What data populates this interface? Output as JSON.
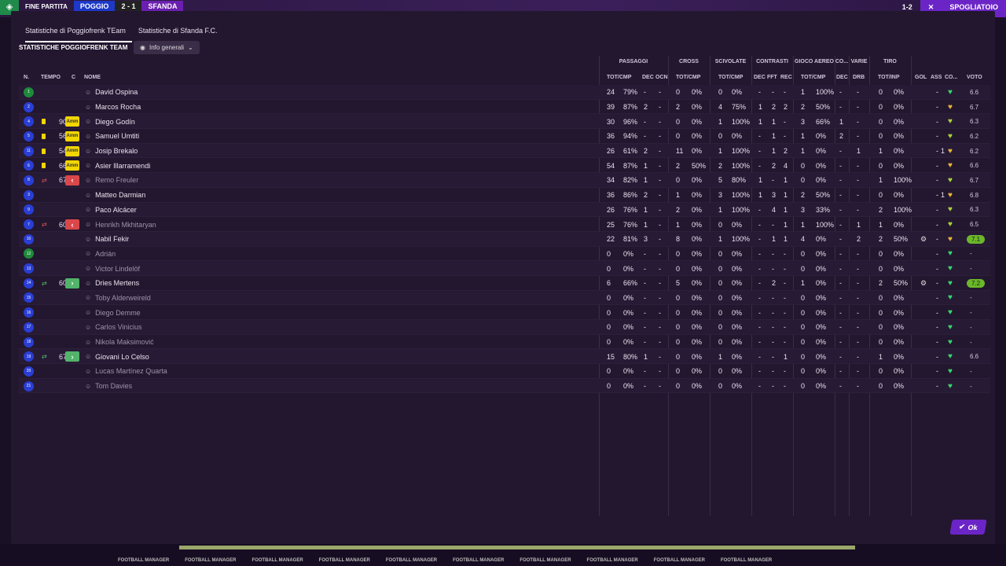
{
  "background": {
    "match_label": "FINE PARTITA",
    "home_team": "POGGIO",
    "score": "2 - 1",
    "away_team": "SFANDA",
    "right_score": "1-2",
    "right_close": "✕",
    "right_action": "SPOGLIATOIO",
    "footer_brand": "FOOTBALL MANAGER"
  },
  "tabs": [
    {
      "label": "Statistiche di Poggiofrenk TEam",
      "active": true
    },
    {
      "label": "Statistiche di Sfanda F.C.",
      "active": false
    }
  ],
  "section_title": "STATISTICHE POGGIOFRENK TEAM",
  "view_select": {
    "label": "Info generali"
  },
  "headers": {
    "n": "N.",
    "tempo": "TEMPO",
    "c": "C",
    "nome": "NOME",
    "groups": {
      "passaggi": "PASSAGGI",
      "cross": "CROSS",
      "scivolate": "SCIVOLATE",
      "contrasti": "CONTRASTI",
      "gioco_aereo": "GIOCO AEREO",
      "co": "CO...",
      "varie": "VARIE",
      "tiro": "TIRO"
    },
    "cols": {
      "pass_tot": "TOT/CMP",
      "pass_dec": "DEC",
      "pass_ocn": "OCN",
      "cross_tot": "TOT/CMP",
      "sciv_tot": "TOT/CMP",
      "con_dec": "DEC",
      "con_fft": "FFT",
      "con_rec": "REC",
      "aereo_tot": "TOT/CMP",
      "co_dec": "DEC",
      "varie_drb": "DRB",
      "tiro_tot": "TOT/INP",
      "gol": "GOL",
      "ass": "ASS",
      "co2": "CO...",
      "voto": "VOTO"
    }
  },
  "players": [
    {
      "n": "1",
      "nb": "green",
      "card": "",
      "tempo": "",
      "pos": "",
      "name": "David Ospina",
      "sub": false,
      "pt": "24",
      "pc": "79%",
      "pcv": 0.79,
      "pd": "-",
      "po": "-",
      "ct": "0",
      "cc": "0%",
      "ccv": 0,
      "st": "0",
      "sc": "0%",
      "scv": 0,
      "cd": "-",
      "cf": "-",
      "cr": "-",
      "at": "1",
      "ac": "100%",
      "acv": 1,
      "cod": "-",
      "drb": "-",
      "tt": "0",
      "tc": "0%",
      "tcv": 0,
      "gol": "",
      "ass": "-",
      "gear": false,
      "heart": "green",
      "voto": "6.6",
      "best": false
    },
    {
      "n": "2",
      "nb": "blue",
      "card": "",
      "tempo": "",
      "pos": "",
      "name": "Marcos Rocha",
      "sub": false,
      "pt": "39",
      "pc": "87%",
      "pcv": 0.87,
      "pd": "2",
      "po": "-",
      "ct": "2",
      "cc": "0%",
      "ccv": 0,
      "st": "4",
      "sc": "75%",
      "scv": 0.75,
      "cd": "1",
      "cf": "2",
      "cr": "2",
      "at": "2",
      "ac": "50%",
      "acv": 0.5,
      "cod": "-",
      "drb": "-",
      "tt": "0",
      "tc": "0%",
      "tcv": 0,
      "gol": "",
      "ass": "-",
      "gear": false,
      "heart": "gold",
      "voto": "6.7",
      "best": false
    },
    {
      "n": "4",
      "nb": "blue",
      "card": "y",
      "tempo": "90",
      "pos": "Amm",
      "name": "Diego Godín",
      "sub": false,
      "pt": "30",
      "pc": "96%",
      "pcv": 0.96,
      "pd": "-",
      "po": "-",
      "ct": "0",
      "cc": "0%",
      "ccv": 0,
      "st": "1",
      "sc": "100%",
      "scv": 1,
      "cd": "1",
      "cf": "1",
      "cr": "-",
      "at": "3",
      "ac": "66%",
      "acv": 0.66,
      "cod": "1",
      "drb": "-",
      "tt": "0",
      "tc": "0%",
      "tcv": 0,
      "gol": "",
      "ass": "-",
      "gear": false,
      "heart": "lime",
      "voto": "6.3",
      "best": false
    },
    {
      "n": "5",
      "nb": "blue",
      "card": "y",
      "tempo": "56",
      "pos": "Amm",
      "name": "Samuel Umtiti",
      "sub": false,
      "pt": "36",
      "pc": "94%",
      "pcv": 0.94,
      "pd": "-",
      "po": "-",
      "ct": "0",
      "cc": "0%",
      "ccv": 0,
      "st": "0",
      "sc": "0%",
      "scv": 0,
      "cd": "-",
      "cf": "1",
      "cr": "-",
      "at": "1",
      "ac": "0%",
      "acv": 0,
      "cod": "2",
      "drb": "-",
      "tt": "0",
      "tc": "0%",
      "tcv": 0,
      "gol": "",
      "ass": "-",
      "gear": false,
      "heart": "lime",
      "voto": "6.2",
      "best": false
    },
    {
      "n": "11",
      "nb": "blue",
      "card": "y",
      "tempo": "54",
      "pos": "Amm",
      "name": "Josip Brekalo",
      "sub": false,
      "pt": "26",
      "pc": "61%",
      "pcv": 0.61,
      "pd": "2",
      "po": "-",
      "ct": "11",
      "cc": "0%",
      "ccv": 0,
      "st": "1",
      "sc": "100%",
      "scv": 1,
      "cd": "-",
      "cf": "1",
      "cr": "2",
      "at": "1",
      "ac": "0%",
      "acv": 0,
      "cod": "-",
      "drb": "1",
      "tt": "1",
      "tc": "0%",
      "tcv": 0,
      "gol": "1",
      "ass": "-",
      "gear": false,
      "heart": "gold",
      "voto": "6.2",
      "best": false
    },
    {
      "n": "6",
      "nb": "blue",
      "card": "y",
      "tempo": "66",
      "pos": "Amm",
      "name": "Asier Illarramendi",
      "sub": false,
      "pt": "54",
      "pc": "87%",
      "pcv": 0.87,
      "pd": "1",
      "po": "-",
      "ct": "2",
      "cc": "50%",
      "ccv": 0.5,
      "st": "2",
      "sc": "100%",
      "scv": 1,
      "cd": "-",
      "cf": "2",
      "cr": "4",
      "at": "0",
      "ac": "0%",
      "acv": 0,
      "cod": "-",
      "drb": "-",
      "tt": "0",
      "tc": "0%",
      "tcv": 0,
      "gol": "",
      "ass": "-",
      "gear": false,
      "heart": "gold",
      "voto": "6.6",
      "best": false
    },
    {
      "n": "8",
      "nb": "blue",
      "card": "out",
      "tempo": "67",
      "pos": "out",
      "name": "Remo Freuler",
      "sub": true,
      "pt": "34",
      "pc": "82%",
      "pcv": 0.82,
      "pd": "1",
      "po": "-",
      "ct": "0",
      "cc": "0%",
      "ccv": 0,
      "st": "5",
      "sc": "80%",
      "scv": 0.8,
      "cd": "1",
      "cf": "-",
      "cr": "1",
      "at": "0",
      "ac": "0%",
      "acv": 0,
      "cod": "-",
      "drb": "-",
      "tt": "1",
      "tc": "100%",
      "tcv": 1,
      "gol": "",
      "ass": "-",
      "gear": false,
      "heart": "lime",
      "voto": "6.7",
      "best": false
    },
    {
      "n": "3",
      "nb": "blue",
      "card": "",
      "tempo": "",
      "pos": "",
      "name": "Matteo Darmian",
      "sub": false,
      "pt": "36",
      "pc": "86%",
      "pcv": 0.86,
      "pd": "2",
      "po": "-",
      "ct": "1",
      "cc": "0%",
      "ccv": 0,
      "st": "3",
      "sc": "100%",
      "scv": 1,
      "cd": "1",
      "cf": "3",
      "cr": "1",
      "at": "2",
      "ac": "50%",
      "acv": 0.5,
      "cod": "-",
      "drb": "-",
      "tt": "0",
      "tc": "0%",
      "tcv": 0,
      "gol": "1",
      "ass": "-",
      "gear": false,
      "heart": "gold",
      "voto": "6.8",
      "best": false
    },
    {
      "n": "9",
      "nb": "blue",
      "card": "",
      "tempo": "",
      "pos": "",
      "name": "Paco Alcácer",
      "sub": false,
      "pt": "26",
      "pc": "76%",
      "pcv": 0.76,
      "pd": "1",
      "po": "-",
      "ct": "2",
      "cc": "0%",
      "ccv": 0,
      "st": "1",
      "sc": "100%",
      "scv": 1,
      "cd": "-",
      "cf": "4",
      "cr": "1",
      "at": "3",
      "ac": "33%",
      "acv": 0.33,
      "cod": "-",
      "drb": "-",
      "tt": "2",
      "tc": "100%",
      "tcv": 1,
      "gol": "",
      "ass": "-",
      "gear": false,
      "heart": "lime",
      "voto": "6.3",
      "best": false
    },
    {
      "n": "7",
      "nb": "blue",
      "card": "out",
      "tempo": "60",
      "pos": "out",
      "name": "Henrikh Mkhitaryan",
      "sub": true,
      "pt": "25",
      "pc": "76%",
      "pcv": 0.76,
      "pd": "1",
      "po": "-",
      "ct": "1",
      "cc": "0%",
      "ccv": 0,
      "st": "0",
      "sc": "0%",
      "scv": 0,
      "cd": "-",
      "cf": "-",
      "cr": "1",
      "at": "1",
      "ac": "100%",
      "acv": 1,
      "cod": "-",
      "drb": "1",
      "tt": "1",
      "tc": "0%",
      "tcv": 0,
      "gol": "",
      "ass": "-",
      "gear": false,
      "heart": "lime",
      "voto": "6.5",
      "best": false
    },
    {
      "n": "10",
      "nb": "blue",
      "card": "",
      "tempo": "",
      "pos": "",
      "name": "Nabil Fekir",
      "sub": false,
      "pt": "22",
      "pc": "81%",
      "pcv": 0.81,
      "pd": "3",
      "po": "-",
      "ct": "8",
      "cc": "0%",
      "ccv": 0,
      "st": "1",
      "sc": "100%",
      "scv": 1,
      "cd": "-",
      "cf": "1",
      "cr": "1",
      "at": "4",
      "ac": "0%",
      "acv": 0,
      "cod": "-",
      "drb": "2",
      "tt": "2",
      "tc": "50%",
      "tcv": 0.5,
      "gol": "",
      "ass": "-",
      "gear": true,
      "heart": "gold",
      "voto": "7.1",
      "best": true
    },
    {
      "n": "12",
      "nb": "green",
      "card": "",
      "tempo": "",
      "pos": "",
      "name": "Adrián",
      "sub": true,
      "pt": "0",
      "pc": "0%",
      "pcv": 0,
      "pd": "-",
      "po": "-",
      "ct": "0",
      "cc": "0%",
      "ccv": 0,
      "st": "0",
      "sc": "0%",
      "scv": 0,
      "cd": "-",
      "cf": "-",
      "cr": "-",
      "at": "0",
      "ac": "0%",
      "acv": 0,
      "cod": "-",
      "drb": "-",
      "tt": "0",
      "tc": "0%",
      "tcv": 0,
      "gol": "",
      "ass": "-",
      "gear": false,
      "heart": "green",
      "voto": "-",
      "best": false
    },
    {
      "n": "13",
      "nb": "blue",
      "card": "",
      "tempo": "",
      "pos": "",
      "name": "Victor Lindelöf",
      "sub": true,
      "pt": "0",
      "pc": "0%",
      "pcv": 0,
      "pd": "-",
      "po": "-",
      "ct": "0",
      "cc": "0%",
      "ccv": 0,
      "st": "0",
      "sc": "0%",
      "scv": 0,
      "cd": "-",
      "cf": "-",
      "cr": "-",
      "at": "0",
      "ac": "0%",
      "acv": 0,
      "cod": "-",
      "drb": "-",
      "tt": "0",
      "tc": "0%",
      "tcv": 0,
      "gol": "",
      "ass": "-",
      "gear": false,
      "heart": "green",
      "voto": "-",
      "best": false
    },
    {
      "n": "14",
      "nb": "blue",
      "card": "in",
      "tempo": "60",
      "pos": "in",
      "name": "Dries Mertens",
      "sub": false,
      "pt": "6",
      "pc": "66%",
      "pcv": 0.66,
      "pd": "-",
      "po": "-",
      "ct": "5",
      "cc": "0%",
      "ccv": 0,
      "st": "0",
      "sc": "0%",
      "scv": 0,
      "cd": "-",
      "cf": "2",
      "cr": "-",
      "at": "1",
      "ac": "0%",
      "acv": 0,
      "cod": "-",
      "drb": "-",
      "tt": "2",
      "tc": "50%",
      "tcv": 0.5,
      "gol": "",
      "ass": "-",
      "gear": true,
      "heart": "green",
      "voto": "7.2",
      "best": true
    },
    {
      "n": "15",
      "nb": "blue",
      "card": "",
      "tempo": "",
      "pos": "",
      "name": "Toby Alderweireld",
      "sub": true,
      "pt": "0",
      "pc": "0%",
      "pcv": 0,
      "pd": "-",
      "po": "-",
      "ct": "0",
      "cc": "0%",
      "ccv": 0,
      "st": "0",
      "sc": "0%",
      "scv": 0,
      "cd": "-",
      "cf": "-",
      "cr": "-",
      "at": "0",
      "ac": "0%",
      "acv": 0,
      "cod": "-",
      "drb": "-",
      "tt": "0",
      "tc": "0%",
      "tcv": 0,
      "gol": "",
      "ass": "-",
      "gear": false,
      "heart": "green",
      "voto": "-",
      "best": false
    },
    {
      "n": "16",
      "nb": "blue",
      "card": "",
      "tempo": "",
      "pos": "",
      "name": "Diego Demme",
      "sub": true,
      "pt": "0",
      "pc": "0%",
      "pcv": 0,
      "pd": "-",
      "po": "-",
      "ct": "0",
      "cc": "0%",
      "ccv": 0,
      "st": "0",
      "sc": "0%",
      "scv": 0,
      "cd": "-",
      "cf": "-",
      "cr": "-",
      "at": "0",
      "ac": "0%",
      "acv": 0,
      "cod": "-",
      "drb": "-",
      "tt": "0",
      "tc": "0%",
      "tcv": 0,
      "gol": "",
      "ass": "-",
      "gear": false,
      "heart": "green",
      "voto": "-",
      "best": false
    },
    {
      "n": "17",
      "nb": "blue",
      "card": "",
      "tempo": "",
      "pos": "",
      "name": "Carlos Vinicius",
      "sub": true,
      "pt": "0",
      "pc": "0%",
      "pcv": 0,
      "pd": "-",
      "po": "-",
      "ct": "0",
      "cc": "0%",
      "ccv": 0,
      "st": "0",
      "sc": "0%",
      "scv": 0,
      "cd": "-",
      "cf": "-",
      "cr": "-",
      "at": "0",
      "ac": "0%",
      "acv": 0,
      "cod": "-",
      "drb": "-",
      "tt": "0",
      "tc": "0%",
      "tcv": 0,
      "gol": "",
      "ass": "-",
      "gear": false,
      "heart": "green",
      "voto": "-",
      "best": false
    },
    {
      "n": "18",
      "nb": "blue",
      "card": "",
      "tempo": "",
      "pos": "",
      "name": "Nikola Maksimović",
      "sub": true,
      "pt": "0",
      "pc": "0%",
      "pcv": 0,
      "pd": "-",
      "po": "-",
      "ct": "0",
      "cc": "0%",
      "ccv": 0,
      "st": "0",
      "sc": "0%",
      "scv": 0,
      "cd": "-",
      "cf": "-",
      "cr": "-",
      "at": "0",
      "ac": "0%",
      "acv": 0,
      "cod": "-",
      "drb": "-",
      "tt": "0",
      "tc": "0%",
      "tcv": 0,
      "gol": "",
      "ass": "-",
      "gear": false,
      "heart": "green",
      "voto": "-",
      "best": false
    },
    {
      "n": "19",
      "nb": "blue",
      "card": "in",
      "tempo": "67",
      "pos": "in",
      "name": "Giovani Lo Celso",
      "sub": false,
      "pt": "15",
      "pc": "80%",
      "pcv": 0.8,
      "pd": "1",
      "po": "-",
      "ct": "0",
      "cc": "0%",
      "ccv": 0,
      "st": "1",
      "sc": "0%",
      "scv": 0,
      "cd": "-",
      "cf": "-",
      "cr": "1",
      "at": "0",
      "ac": "0%",
      "acv": 0,
      "cod": "-",
      "drb": "-",
      "tt": "1",
      "tc": "0%",
      "tcv": 0,
      "gol": "",
      "ass": "-",
      "gear": false,
      "heart": "green",
      "voto": "6.6",
      "best": false
    },
    {
      "n": "20",
      "nb": "blue",
      "card": "",
      "tempo": "",
      "pos": "",
      "name": "Lucas Martínez Quarta",
      "sub": true,
      "pt": "0",
      "pc": "0%",
      "pcv": 0,
      "pd": "-",
      "po": "-",
      "ct": "0",
      "cc": "0%",
      "ccv": 0,
      "st": "0",
      "sc": "0%",
      "scv": 0,
      "cd": "-",
      "cf": "-",
      "cr": "-",
      "at": "0",
      "ac": "0%",
      "acv": 0,
      "cod": "-",
      "drb": "-",
      "tt": "0",
      "tc": "0%",
      "tcv": 0,
      "gol": "",
      "ass": "-",
      "gear": false,
      "heart": "green",
      "voto": "-",
      "best": false
    },
    {
      "n": "21",
      "nb": "blue",
      "card": "",
      "tempo": "",
      "pos": "",
      "name": "Tom Davies",
      "sub": true,
      "pt": "0",
      "pc": "0%",
      "pcv": 0,
      "pd": "-",
      "po": "-",
      "ct": "0",
      "cc": "0%",
      "ccv": 0,
      "st": "0",
      "sc": "0%",
      "scv": 0,
      "cd": "-",
      "cf": "-",
      "cr": "-",
      "at": "0",
      "ac": "0%",
      "acv": 0,
      "cod": "-",
      "drb": "-",
      "tt": "0",
      "tc": "0%",
      "tcv": 0,
      "gol": "",
      "ass": "-",
      "gear": false,
      "heart": "green",
      "voto": "-",
      "best": false
    }
  ],
  "ok_label": "Ok",
  "colors": {
    "accent": "#6b25c7",
    "bar": "#8a3bd6",
    "card_yellow": "#f2d600",
    "sub_out": "#d9474a",
    "sub_in": "#52b36a"
  }
}
